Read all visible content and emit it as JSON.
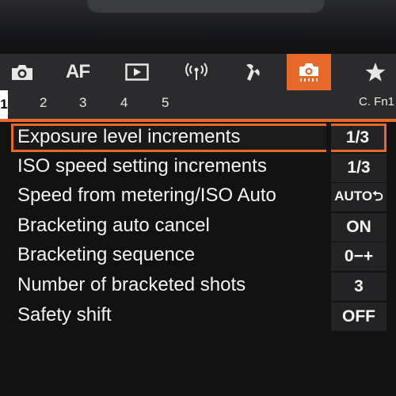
{
  "tabs": [
    {
      "name": "shooting",
      "icon": "camera-icon",
      "label": ""
    },
    {
      "name": "af",
      "icon": "",
      "label": "AF"
    },
    {
      "name": "playback",
      "icon": "play-icon",
      "label": ""
    },
    {
      "name": "wireless",
      "icon": "wireless-icon",
      "label": ""
    },
    {
      "name": "setup",
      "icon": "wrench-icon",
      "label": ""
    },
    {
      "name": "custom-functions",
      "icon": "custom-camera-icon",
      "label": "",
      "active": true
    },
    {
      "name": "my-menu",
      "icon": "star-icon",
      "label": ""
    }
  ],
  "pages": {
    "active": "1",
    "others": [
      "2",
      "3",
      "4",
      "5"
    ],
    "section_label": "C. Fn1"
  },
  "menu": {
    "items": [
      {
        "label": "Exposure level increments",
        "value": "1/3",
        "selected": true
      },
      {
        "label": "ISO speed setting increments",
        "value": "1/3"
      },
      {
        "label": "Speed from metering/ISO Auto",
        "value": "AUTO⮌"
      },
      {
        "label": "Bracketing auto cancel",
        "value": "ON"
      },
      {
        "label": "Bracketing sequence",
        "value": "0−+"
      },
      {
        "label": "Number of bracketed shots",
        "value": "3"
      },
      {
        "label": "Safety shift",
        "value": "OFF"
      }
    ]
  },
  "colors": {
    "accent": "#e8682a",
    "bar_bg": "#2b2b2d",
    "screen_bg": "#121213"
  }
}
